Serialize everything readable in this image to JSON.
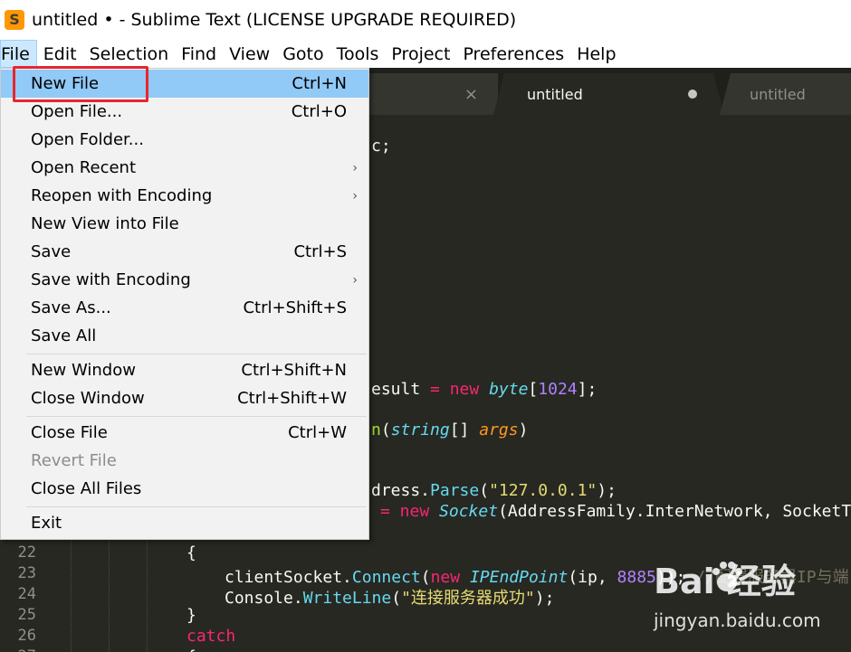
{
  "window": {
    "title": "untitled • - Sublime Text (LICENSE UPGRADE REQUIRED)",
    "logo_glyph": "S",
    "logo_color": "#ff9800"
  },
  "menubar": {
    "items": [
      "File",
      "Edit",
      "Selection",
      "Find",
      "View",
      "Goto",
      "Tools",
      "Project",
      "Preferences",
      "Help"
    ]
  },
  "tabs": [
    {
      "label": "",
      "close_glyph": "×"
    },
    {
      "label": "untitled",
      "dirty": true
    },
    {
      "label": "untitled"
    }
  ],
  "file_menu": {
    "items": [
      {
        "label": "New File",
        "shortcut": "Ctrl+N",
        "highlighted": true
      },
      {
        "label": "Open File...",
        "shortcut": "Ctrl+O"
      },
      {
        "label": "Open Folder...",
        "shortcut": ""
      },
      {
        "label": "Open Recent",
        "submenu": true
      },
      {
        "label": "Reopen with Encoding",
        "submenu": true
      },
      {
        "label": "New View into File",
        "shortcut": ""
      },
      {
        "label": "Save",
        "shortcut": "Ctrl+S"
      },
      {
        "label": "Save with Encoding",
        "submenu": true
      },
      {
        "label": "Save As...",
        "shortcut": "Ctrl+Shift+S"
      },
      {
        "label": "Save All",
        "shortcut": ""
      },
      {
        "label": "New Window",
        "shortcut": "Ctrl+Shift+N"
      },
      {
        "label": "Close Window",
        "shortcut": "Ctrl+Shift+W"
      },
      {
        "label": "Close File",
        "shortcut": "Ctrl+W"
      },
      {
        "label": "Revert File",
        "shortcut": "",
        "disabled": true
      },
      {
        "label": "Close All Files",
        "shortcut": ""
      },
      {
        "label": "Exit",
        "shortcut": ""
      }
    ],
    "arrow_glyph": "›"
  },
  "editor": {
    "line_numbers": [
      "22",
      "23",
      "24",
      "25",
      "26",
      "27"
    ],
    "visible_fragments": {
      "l1": "c;",
      "l2_a": "esult ",
      "l2_eq": "=",
      "l2_new": " new ",
      "l2_type": "byte",
      "l2_b": "[",
      "l2_num": "1024",
      "l2_c": "];",
      "l3_fn": "n",
      "l3_a": "(",
      "l3_type": "string",
      "l3_b": "[] ",
      "l3_param": "args",
      "l3_c": ")",
      "l4_a": "dress.",
      "l4_fn": "Parse",
      "l4_b": "(",
      "l4_str": "\"127.0.0.1\"",
      "l4_c": ");",
      "l5_eq": "=",
      "l5_new": " new ",
      "l5_type": "Socket",
      "l5_b": "(AddressFamily.InterNetwork, SocketTy",
      "l22": "{",
      "l23_a": "clientSocket.",
      "l23_fn": "Connect",
      "l23_b": "(",
      "l23_new": "new ",
      "l23_type": "IPEndPoint",
      "l23_c": "(ip, ",
      "l23_num": "8885",
      "l23_d": ")); ",
      "l23_cmt": "//配置服务器IP与端",
      "l24_a": "Console.",
      "l24_fn": "WriteLine",
      "l24_b": "(",
      "l24_str": "\"连接服务器成功\"",
      "l24_c": ");",
      "l25": "}",
      "l26": "catch",
      "l27": "{"
    }
  },
  "watermark": {
    "logo": "Bai  经验",
    "url": "jingyan.baidu.com"
  },
  "colors": {
    "editor_bg": "#272822",
    "menu_highlight": "#91c9f7",
    "annotation_red": "#e8262c"
  }
}
